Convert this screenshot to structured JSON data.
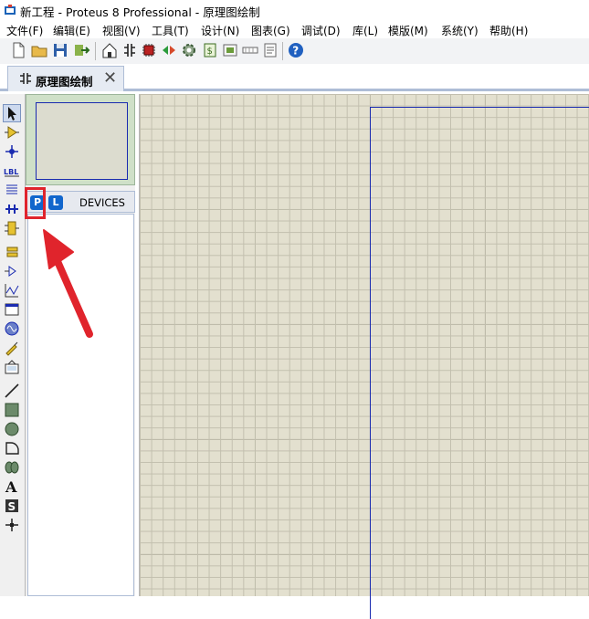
{
  "window": {
    "title": "新工程 - Proteus 8 Professional - 原理图绘制"
  },
  "menu": {
    "items": [
      "文件(F)",
      "编辑(E)",
      "视图(V)",
      "工具(T)",
      "设计(N)",
      "图表(G)",
      "调试(D)",
      "库(L)",
      "模版(M)",
      "系统(Y)",
      "帮助(H)"
    ]
  },
  "tabs": {
    "active_label": "原理图绘制",
    "close_glyph": "✕"
  },
  "panel": {
    "p_button": "P",
    "l_button": "L",
    "devices_label": "DEVICES"
  },
  "annotation": {
    "highlight_color": "#e0242c",
    "arrow_color": "#e0242c"
  },
  "colors": {
    "canvas_bg": "#e3e0cf",
    "sheet_border": "#1a2bb0",
    "overview_bg": "#cfe0c8",
    "pl_button": "#1166cc"
  }
}
